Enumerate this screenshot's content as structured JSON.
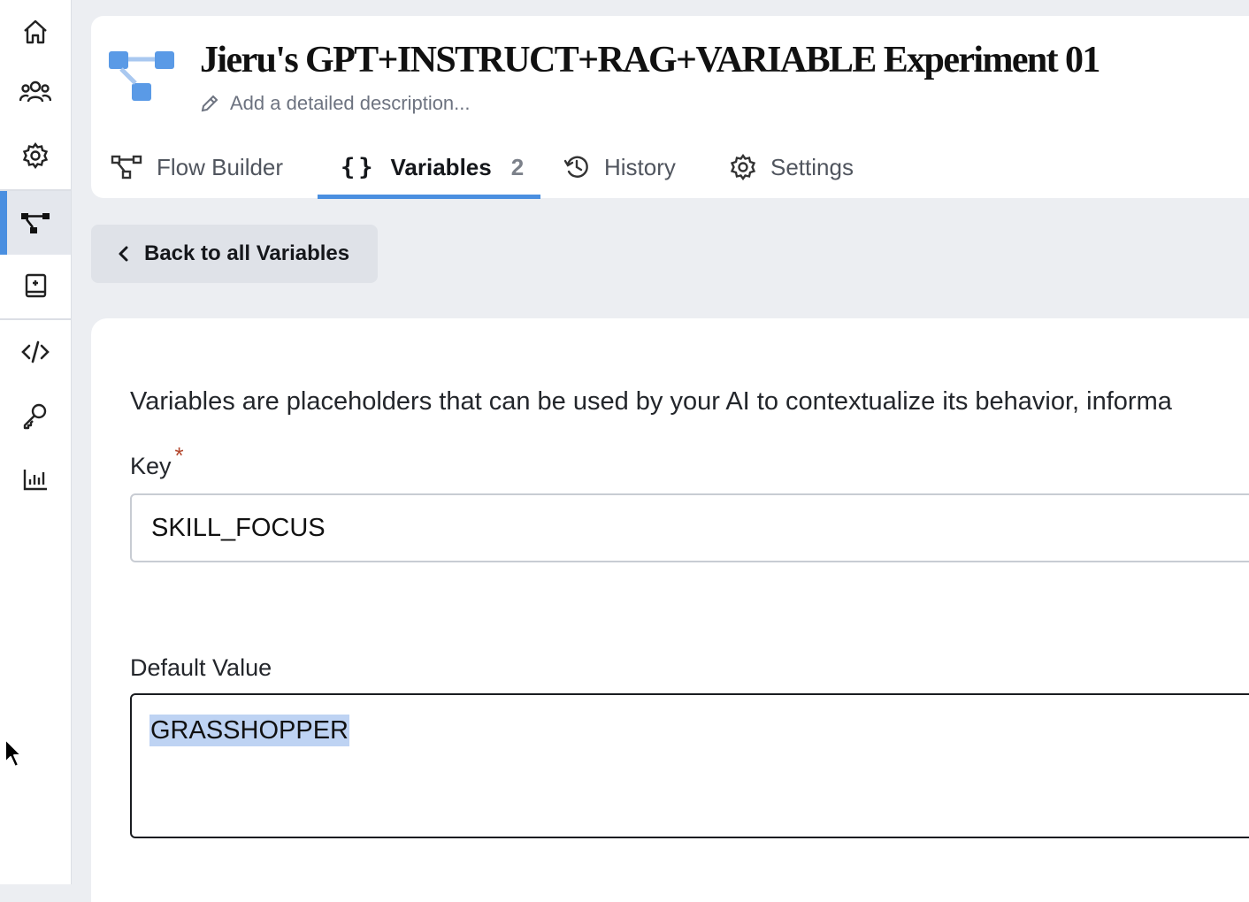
{
  "rail": {
    "items": [
      {
        "icon": "home-icon"
      },
      {
        "icon": "users-icon"
      },
      {
        "icon": "gear-icon"
      },
      {
        "icon": "flow-icon",
        "active": true
      },
      {
        "icon": "knowledge-icon"
      },
      {
        "icon": "code-icon"
      },
      {
        "icon": "key-icon"
      },
      {
        "icon": "analytics-icon"
      }
    ]
  },
  "header": {
    "title": "Jieru's GPT+INSTRUCT+RAG+VARIABLE Experiment 01",
    "description_placeholder": "Add a detailed description...",
    "tabs": [
      {
        "label": "Flow Builder",
        "icon": "flow-builder-icon"
      },
      {
        "label": "Variables",
        "icon": "braces-icon",
        "count": "2",
        "active": true
      },
      {
        "label": "History",
        "icon": "history-icon"
      },
      {
        "label": "Settings",
        "icon": "gear-icon"
      }
    ]
  },
  "back_button": {
    "label": "Back to all Variables"
  },
  "form": {
    "intro": "Variables are placeholders that can be used by your AI to contextualize its behavior, informa",
    "key_label": "Key",
    "required_mark": "*",
    "key_value": "SKILL_FOCUS",
    "default_label": "Default Value",
    "default_value": "GRASSHOPPER"
  },
  "colors": {
    "accent": "#4a8fe0",
    "selection": "#bed3f3",
    "required": "#b3462c"
  }
}
